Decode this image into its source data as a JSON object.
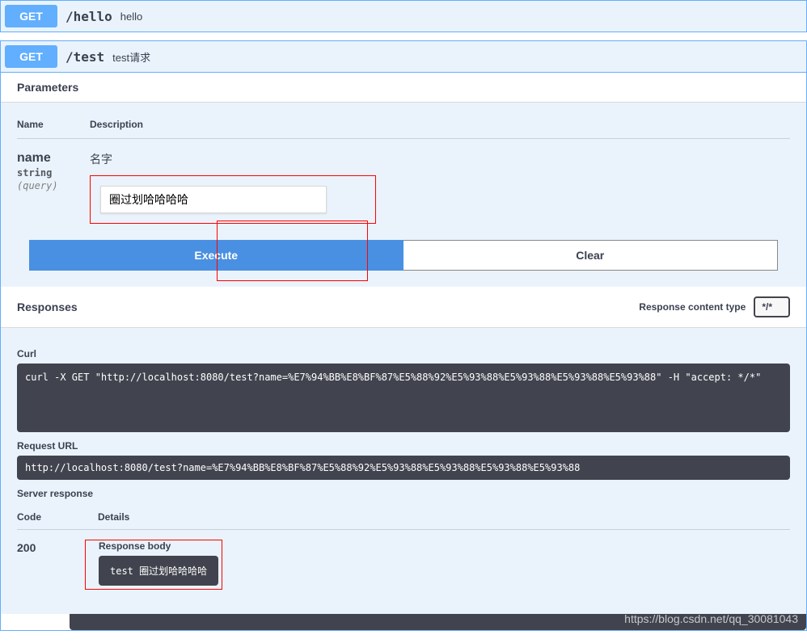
{
  "op1": {
    "method": "GET",
    "path": "/hello",
    "desc": "hello"
  },
  "op2": {
    "method": "GET",
    "path": "/test",
    "desc": "test请求",
    "parameters_title": "Parameters",
    "col_name": "Name",
    "col_desc": "Description",
    "param": {
      "name": "name",
      "type": "string",
      "in": "(query)",
      "desc": "名字",
      "value": "圈过划哈哈哈哈"
    },
    "btn_execute": "Execute",
    "btn_clear": "Clear",
    "responses_title": "Responses",
    "resp_ctype_label": "Response content type",
    "resp_ctype_value": "*/*",
    "curl_label": "Curl",
    "curl_cmd": "curl -X GET \"http://localhost:8080/test?name=%E7%94%BB%E8%BF%87%E5%88%92%E5%93%88%E5%93%88%E5%93%88%E5%93%88\" -H \"accept: */*\"",
    "requrl_label": "Request URL",
    "requrl_value": "http://localhost:8080/test?name=%E7%94%BB%E8%BF%87%E5%88%92%E5%93%88%E5%93%88%E5%93%88%E5%93%88",
    "server_resp_label": "Server response",
    "code_label": "Code",
    "details_label": "Details",
    "resp_code": "200",
    "resp_body_label": "Response body",
    "resp_body_value": "test 圈过划哈哈哈哈"
  },
  "watermark": "https://blog.csdn.net/qq_30081043"
}
